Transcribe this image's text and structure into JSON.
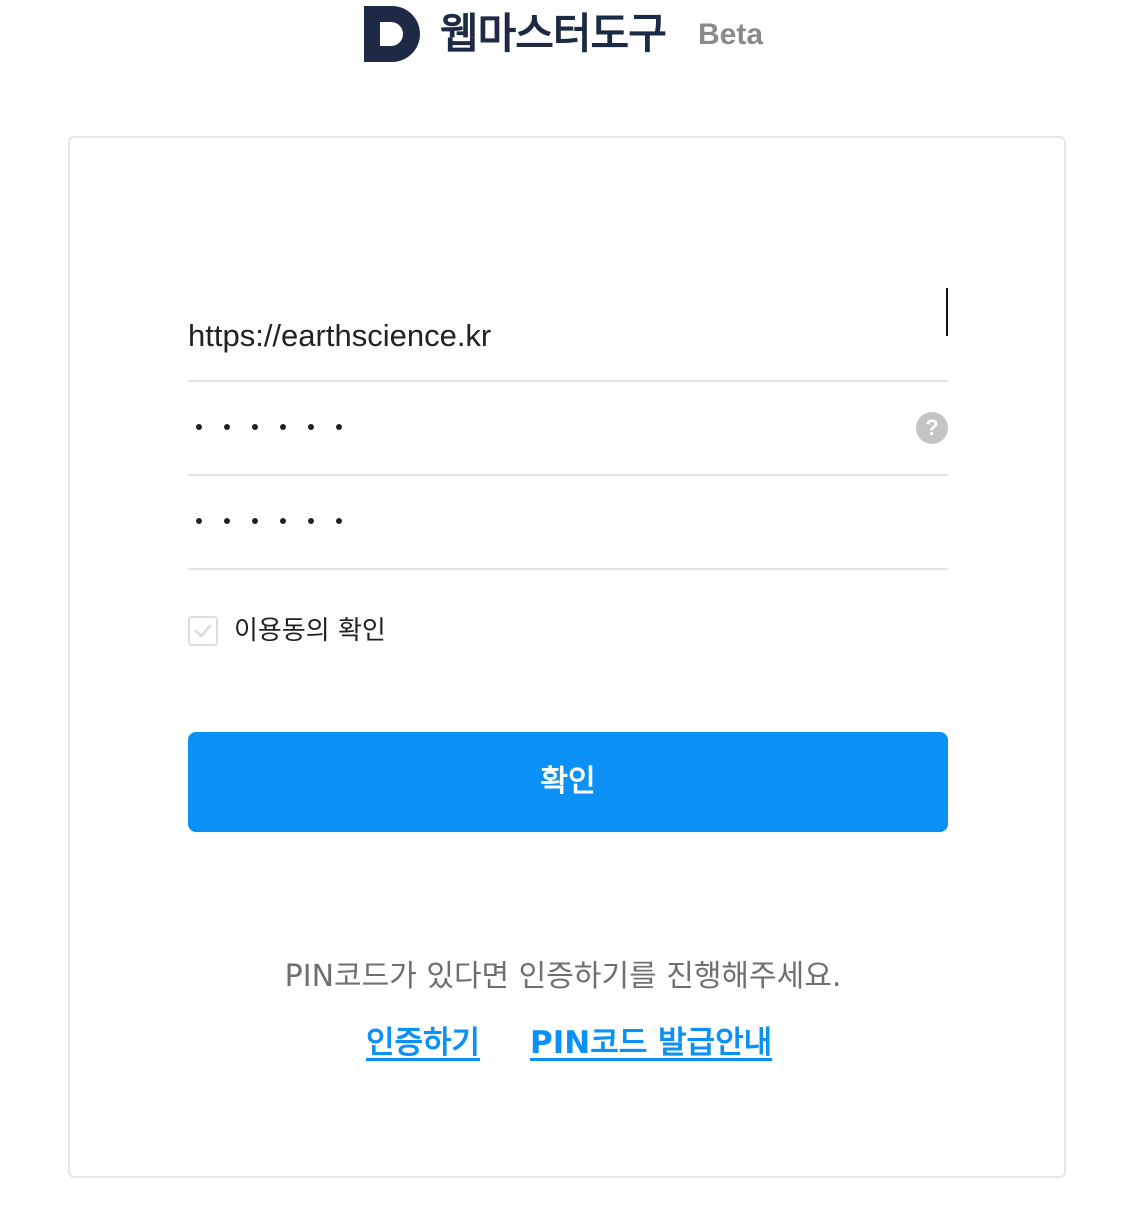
{
  "header": {
    "brand_name": "웹마스터도구",
    "beta_label": "Beta",
    "logo_letter": "D",
    "logo_color": "#1e2a45"
  },
  "form": {
    "site_url_value": "https://earthscience.kr",
    "password_masked": "••••••",
    "password_confirm_masked": "••••••",
    "help_icon_glyph": "?",
    "agree_label": "이용동의 확인",
    "agree_checked": true,
    "confirm_button_label": "확인"
  },
  "footer": {
    "pin_notice": "PIN코드가 있다면 인증하기를 진행해주세요.",
    "verify_link_label": "인증하기",
    "pin_guide_link_label": "PIN코드 발급안내"
  },
  "colors": {
    "primary": "#0b90f5",
    "brand_dark": "#1e2a45",
    "muted_text": "#6f6f6f",
    "border": "#e4e4e4"
  }
}
